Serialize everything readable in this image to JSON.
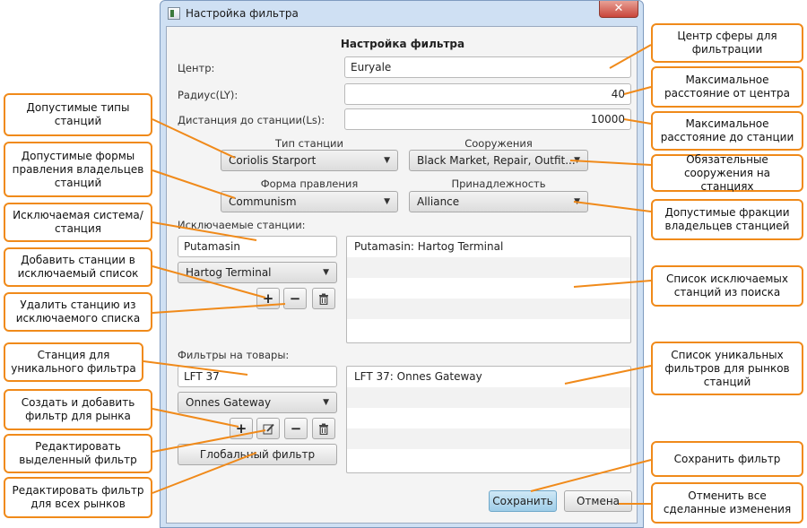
{
  "window": {
    "title": "Настройка фильтра",
    "close_glyph": "✕"
  },
  "form": {
    "heading": "Настройка фильтра",
    "center_label": "Центр:",
    "center_value": "Euryale",
    "radius_label": "Радиус(LY):",
    "radius_value": "40",
    "distance_label": "Дистанция до станции(Ls):",
    "distance_value": "10000",
    "station_type_label": "Тип станции",
    "station_type_value": "Coriolis Starport",
    "services_label": "Сооружения",
    "services_value": "Black Market, Repair, Outfit...",
    "government_label": "Форма правления",
    "government_value": "Communism",
    "allegiance_label": "Принадлежность",
    "allegiance_value": "Alliance",
    "excluded_label": "Исключаемые станции:",
    "excluded_system_value": "Putamasin",
    "excluded_station_value": "Hartog Terminal",
    "excluded_list": [
      "Putamasin: Hartog Terminal"
    ],
    "goods_label": "Фильтры на товары:",
    "goods_system_value": "LFT 37",
    "goods_station_value": "Onnes Gateway",
    "goods_list": [
      "LFT 37: Onnes Gateway"
    ],
    "global_filter_label": "Глобальный фильтр",
    "save_label": "Сохранить",
    "cancel_label": "Отмена",
    "add_glyph": "+",
    "remove_glyph": "−",
    "dropdown_glyph": "▼"
  },
  "callouts": {
    "center": "Центр сферы для фильтрации",
    "radius": "Максимальное расстояние от центра",
    "distance": "Максимальное расстояние до станции",
    "services": "Обязательные сооружения на станциях",
    "allegiance": "Допустимые фракции владельцев станцией",
    "excluded_list": "Список исключаемых станций из поиска",
    "goods_list": "Список уникальных фильтров для рынков станций",
    "save": "Сохранить фильтр",
    "cancel": "Отменить все сделанные изменения",
    "station_types": "Допустимые типы станций",
    "government": "Допустимые формы правления владельцев станций",
    "excluded_system": "Исключаемая система/станция",
    "add_excluded": "Добавить станции в исключаемый список",
    "remove_excluded": "Удалить станцию из исключаемого списка",
    "unique_station": "Станция для уникального фильтра",
    "create_market": "Создать и добавить фильтр для рынка",
    "edit_selected": "Редактировать выделенный фильтр",
    "edit_all": "Редактировать фильтр для всех рынков"
  },
  "colors": {
    "callout_border": "#f08a1a",
    "window_frame": "#cfe0f3",
    "close_button": "#c9453a",
    "default_button": "#9fcde8"
  }
}
